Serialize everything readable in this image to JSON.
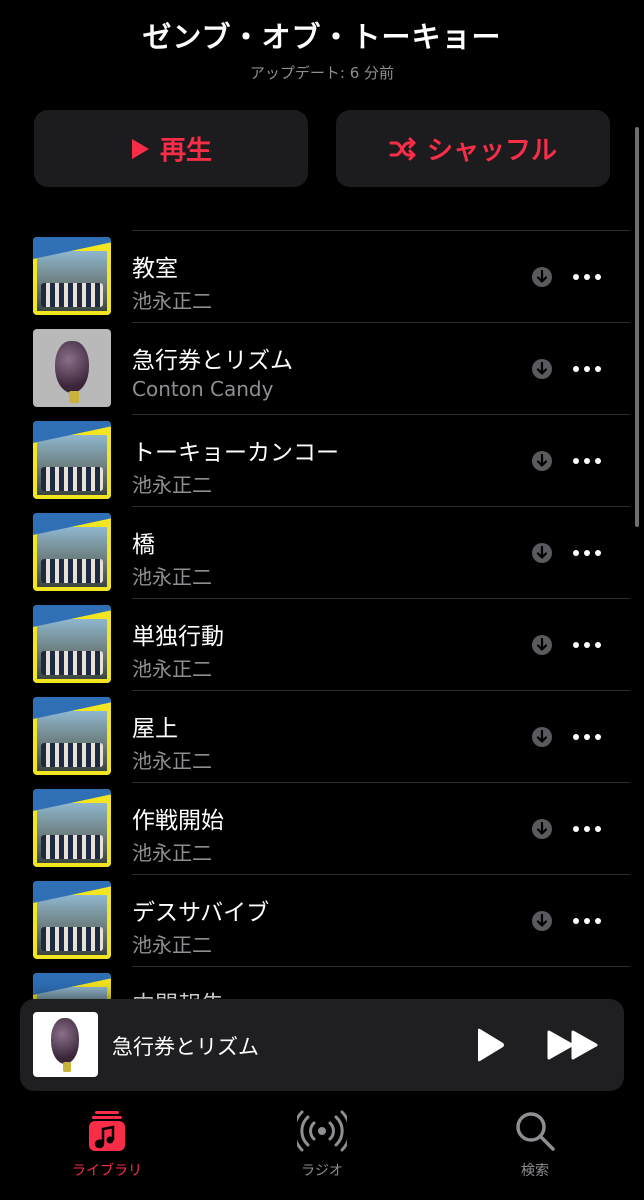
{
  "header": {
    "title": "ゼンブ・オブ・トーキョー",
    "subtitle": "アップデート: 6 分前"
  },
  "actions": {
    "play_label": "再生",
    "shuffle_label": "シャッフル",
    "accent_color": "#fa2d48"
  },
  "tracks": [
    {
      "title": "教室",
      "artist": "池永正二",
      "art": "album-cover"
    },
    {
      "title": "急行券とリズム",
      "artist": "Conton Candy",
      "art": "grape-cover"
    },
    {
      "title": "トーキョーカンコー",
      "artist": "池永正二",
      "art": "album-cover"
    },
    {
      "title": "橋",
      "artist": "池永正二",
      "art": "album-cover"
    },
    {
      "title": "単独行動",
      "artist": "池永正二",
      "art": "album-cover"
    },
    {
      "title": "屋上",
      "artist": "池永正二",
      "art": "album-cover"
    },
    {
      "title": "作戦開始",
      "artist": "池永正二",
      "art": "album-cover"
    },
    {
      "title": "デスサバイブ",
      "artist": "池永正二",
      "art": "album-cover"
    },
    {
      "title": "中間報告",
      "artist": "",
      "art": "album-cover"
    }
  ],
  "now_playing": {
    "title": "急行券とリズム"
  },
  "tabs": [
    {
      "label": "ライブラリ",
      "icon": "music-library-icon",
      "active": true
    },
    {
      "label": "ラジオ",
      "icon": "radio-icon",
      "active": false
    },
    {
      "label": "検索",
      "icon": "search-icon",
      "active": false
    }
  ]
}
